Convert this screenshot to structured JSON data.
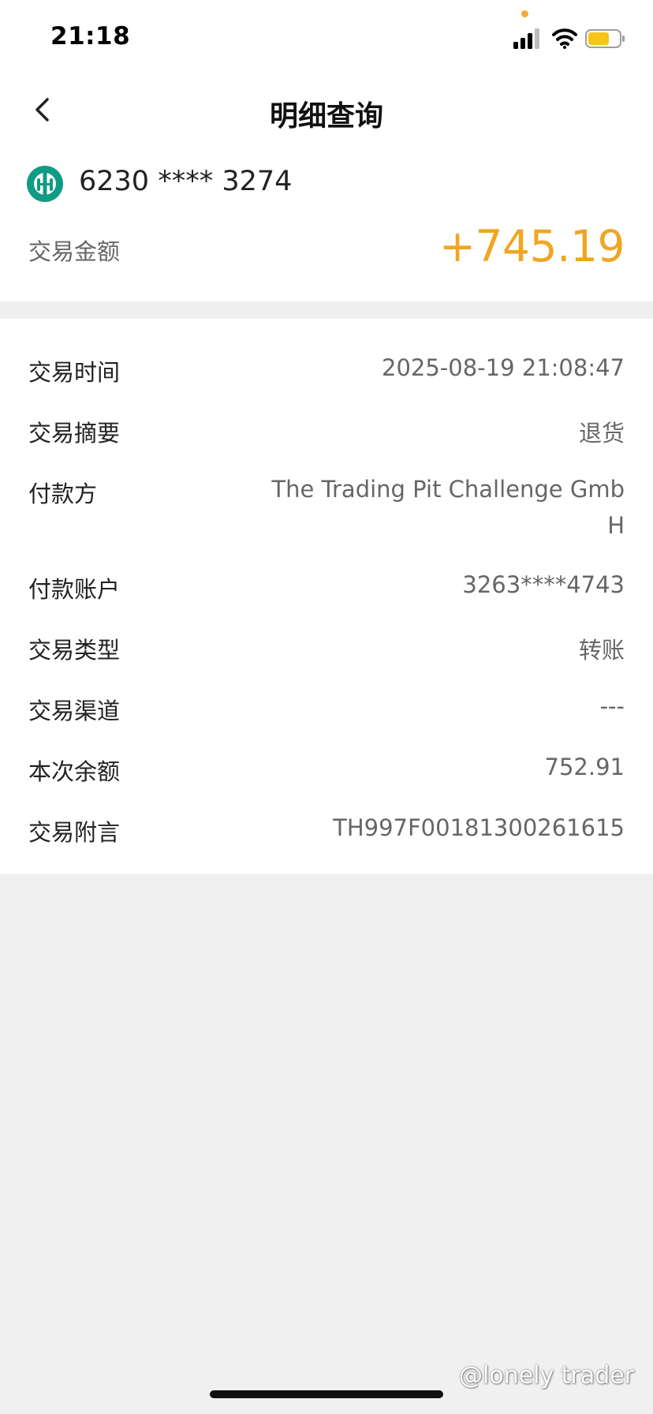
{
  "status_bar": {
    "time": "21:18",
    "icons": [
      "signal-icon",
      "wifi-icon",
      "battery-icon"
    ],
    "battery_color": "#f5c518"
  },
  "header": {
    "title": "明细查询",
    "back_icon": "chevron-left-icon"
  },
  "account": {
    "bank_logo": "bank-logo-icon",
    "number": "6230 **** 3274",
    "amount_label": "交易金额",
    "amount_value": "+745.19",
    "amount_color": "#f1a523"
  },
  "details": [
    {
      "label": "交易时间",
      "value": "2025-08-19 21:08:47"
    },
    {
      "label": "交易摘要",
      "value": "退货"
    },
    {
      "label": "付款方",
      "value": "The Trading Pit Challenge GmbH"
    },
    {
      "label": "付款账户",
      "value": "3263****4743"
    },
    {
      "label": "交易类型",
      "value": "转账"
    },
    {
      "label": "交易渠道",
      "value": "---"
    },
    {
      "label": "本次余额",
      "value": "752.91"
    },
    {
      "label": "交易附言",
      "value": "TH997F00181300261615"
    }
  ],
  "watermark": "@lonely trader"
}
